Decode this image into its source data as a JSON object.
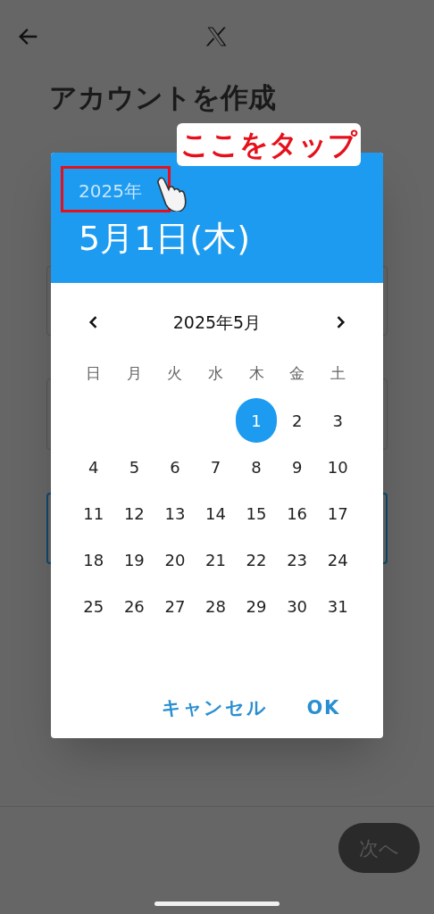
{
  "top_bar": {
    "title": "アカウントを作成"
  },
  "dialog": {
    "year": "2025年",
    "date": "5月1日(木)",
    "month": "2025年5月",
    "weekdays": [
      "日",
      "月",
      "火",
      "水",
      "木",
      "金",
      "土"
    ],
    "weeks": [
      [
        {
          "day": "1",
          "selected": true
        },
        {
          "day": "2",
          "selected": false
        },
        {
          "day": "3",
          "selected": false
        }
      ],
      [
        {
          "day": "4",
          "selected": false
        },
        {
          "day": "5",
          "selected": false
        },
        {
          "day": "6",
          "selected": false
        },
        {
          "day": "7",
          "selected": false
        },
        {
          "day": "8",
          "selected": false
        },
        {
          "day": "9",
          "selected": false
        },
        {
          "day": "10",
          "selected": false
        }
      ],
      [
        {
          "day": "11",
          "selected": false
        },
        {
          "day": "12",
          "selected": false
        },
        {
          "day": "13",
          "selected": false
        },
        {
          "day": "14",
          "selected": false
        },
        {
          "day": "15",
          "selected": false
        },
        {
          "day": "16",
          "selected": false
        },
        {
          "day": "17",
          "selected": false
        }
      ],
      [
        {
          "day": "18",
          "selected": false
        },
        {
          "day": "19",
          "selected": false
        },
        {
          "day": "20",
          "selected": false
        },
        {
          "day": "21",
          "selected": false
        },
        {
          "day": "22",
          "selected": false
        },
        {
          "day": "23",
          "selected": false
        },
        {
          "day": "24",
          "selected": false
        }
      ],
      [
        {
          "day": "25",
          "selected": false
        },
        {
          "day": "26",
          "selected": false
        },
        {
          "day": "27",
          "selected": false
        },
        {
          "day": "28",
          "selected": false
        },
        {
          "day": "29",
          "selected": false
        },
        {
          "day": "30",
          "selected": false
        },
        {
          "day": "31",
          "selected": false
        }
      ]
    ],
    "buttons": [
      "キャンセル",
      "OK"
    ]
  },
  "annotation": {
    "text": "ここをタップ"
  },
  "next_button": {
    "label": "次へ",
    "disabled": true
  }
}
